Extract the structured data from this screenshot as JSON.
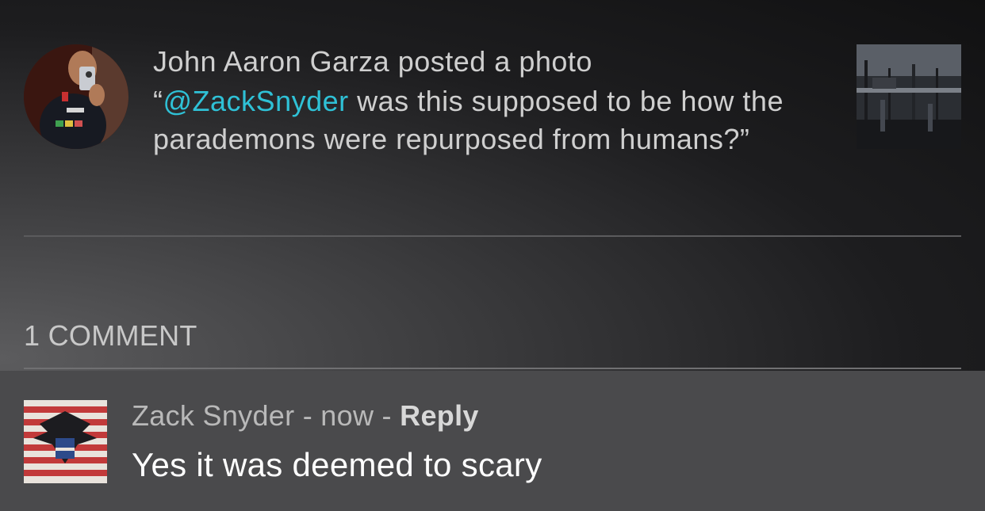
{
  "post": {
    "author": "John Aaron Garza",
    "action": "posted a photo",
    "caption_open_quote": "“",
    "mention": "@ZackSnyder",
    "caption_rest": " was this supposed to be how the parademons were repurposed from humans?",
    "caption_close_quote": "”"
  },
  "comments_section": {
    "count_label": "1 COMMENT"
  },
  "comment": {
    "author": "Zack Snyder",
    "separator_1": " - ",
    "time": "now",
    "separator_2": " - ",
    "reply_label": "Reply",
    "text": "Yes it was deemed to scary"
  },
  "colors": {
    "mention": "#2fc1d6",
    "comment_bg": "#4a4a4c"
  }
}
